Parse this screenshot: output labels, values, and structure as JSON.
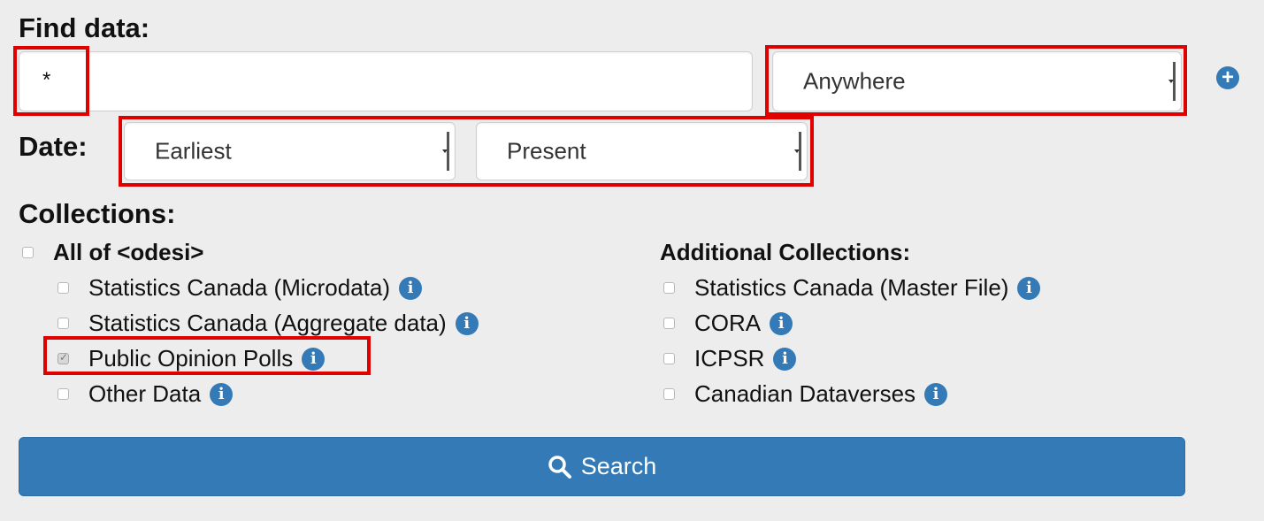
{
  "find_data": {
    "heading": "Find data:",
    "query_value": "*",
    "scope_selected": "Anywhere",
    "add_icon": "plus-circle-icon"
  },
  "date": {
    "heading": "Date:",
    "from_selected": "Earliest",
    "to_selected": "Present"
  },
  "collections": {
    "heading": "Collections:",
    "all_label": "All of <odesi>",
    "odesi_items": [
      {
        "label": "Statistics Canada (Microdata)",
        "checked": false
      },
      {
        "label": "Statistics Canada (Aggregate data)",
        "checked": false
      },
      {
        "label": "Public Opinion Polls",
        "checked": true
      },
      {
        "label": "Other Data",
        "checked": false
      }
    ],
    "additional_heading": "Additional Collections:",
    "additional_items": [
      {
        "label": "Statistics Canada (Master File)",
        "checked": false
      },
      {
        "label": "CORA",
        "checked": false
      },
      {
        "label": "ICPSR",
        "checked": false
      },
      {
        "label": "Canadian Dataverses",
        "checked": false
      }
    ],
    "info_icon": "info-icon"
  },
  "search_button": {
    "label": "Search",
    "icon": "search-icon"
  },
  "colors": {
    "accent": "#337ab7",
    "highlight": "#e00000",
    "background": "#ededed"
  }
}
